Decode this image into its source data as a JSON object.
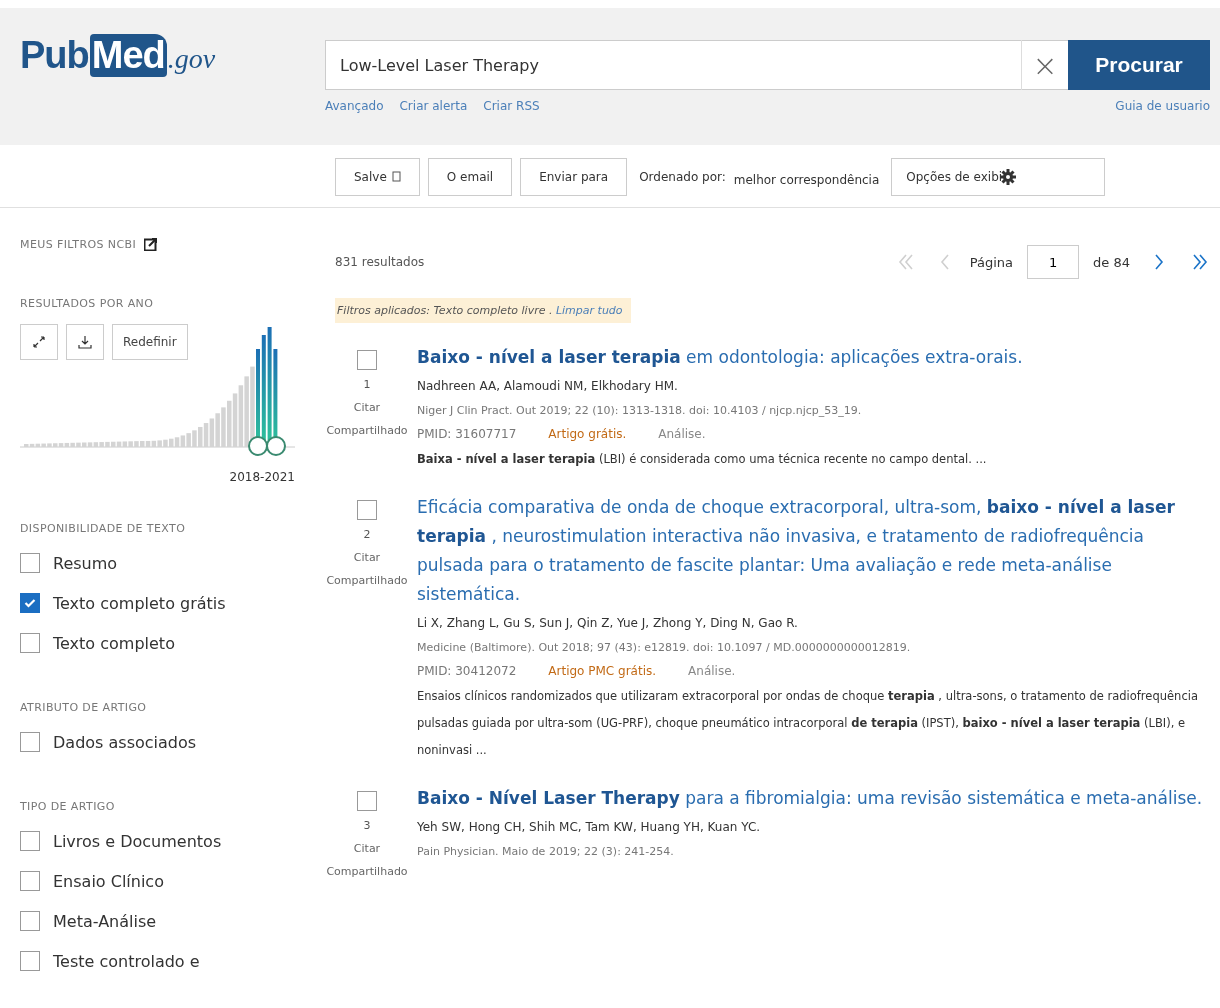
{
  "header": {
    "logo": {
      "prefix": "Pub",
      "main": "Med",
      "suffix": ".gov"
    },
    "search": {
      "value": "Low-Level Laser Therapy",
      "clear": "×",
      "button": "Procurar"
    },
    "links": [
      "Avançado",
      "Criar alerta",
      "Criar RSS"
    ],
    "guide_link": "Guia de usuario"
  },
  "toolbar": {
    "buttons": [
      {
        "kind": "save",
        "label": "Salve"
      },
      {
        "kind": "plain",
        "label": "O email"
      },
      {
        "kind": "plain",
        "label": "Enviar para"
      }
    ],
    "sort_label": "Ordenado por:",
    "sort_value": "melhor correspondência",
    "display_button": "Opções de exibi"
  },
  "sidebar": {
    "my_filters": "MEUS FILTROS NCBI",
    "year_section": {
      "title": "RESULTADOS POR ANO",
      "reset": "Redefinir",
      "range": "2018-2021"
    },
    "groups": [
      {
        "title": "DISPONIBILIDADE DE TEXTO",
        "items": [
          {
            "label": "Resumo",
            "checked": false
          },
          {
            "label": "Texto completo grátis",
            "checked": true
          },
          {
            "label": "Texto completo",
            "checked": false
          }
        ]
      },
      {
        "title": "ATRIBUTO DE ARTIGO",
        "items": [
          {
            "label": "Dados associados",
            "checked": false
          }
        ]
      },
      {
        "title": "TIPO DE ARTIGO",
        "items": [
          {
            "label": "Livros e Documentos",
            "checked": false
          },
          {
            "label": "Ensaio Clínico",
            "checked": false
          },
          {
            "label": "Meta-Análise",
            "checked": false
          },
          {
            "label": "Teste controlado e",
            "checked": false
          }
        ]
      }
    ]
  },
  "results_count": "831 resultados",
  "pager": {
    "label": "Página",
    "value": "1",
    "total": "de 84",
    "buttons": [
      {
        "kind": "first",
        "disabled": true
      },
      {
        "kind": "prev",
        "disabled": true
      },
      {
        "kind": "next",
        "disabled": false
      },
      {
        "kind": "last",
        "disabled": false
      }
    ]
  },
  "applied_filters": {
    "text": "Filtros aplicados: Texto completo livre .",
    "clear": "Limpar tudo"
  },
  "results": [
    {
      "number": "1",
      "checked": false,
      "cite": "Citar",
      "share": "Compartilhado",
      "title": "**Baixo - nível a laser terapia** em odontologia: aplicações extra-orais.",
      "authors": "Nadhreen AA, Alamoudi NM, Elkhodary HM.",
      "citation": "Niger J Clin Pract. Out 2019; 22 (10): 1313-1318. doi: 10.4103 / njcp.njcp_53_19.",
      "pmid": "PMID: 31607717",
      "badge": "Artigo grátis.",
      "type": "Análise.",
      "snippet": "**Baixa - nível a laser terapia** (LBI) é considerada como uma técnica recente no campo dental. ..."
    },
    {
      "number": "2",
      "checked": false,
      "cite": "Citar",
      "share": "Compartilhado",
      "title": "Eficácia comparativa de onda de choque extracorporal, ultra-som, **baixo - nível a laser terapia** , neurostimulation interactiva não invasiva, e tratamento de radiofrequência pulsada para o tratamento de fascite plantar: Uma avaliação e rede meta-análise sistemática.",
      "authors": "Li X, Zhang L, Gu S, Sun J, Qin Z, Yue J, Zhong Y, Ding N, Gao R.",
      "citation": "Medicine (Baltimore). Out 2018; 97 (43): e12819. doi: 10.1097 / MD.0000000000012819.",
      "pmid": "PMID: 30412072",
      "badge": "Artigo PMC grátis.",
      "type": "Análise.",
      "snippet": "Ensaios clínicos randomizados que utilizaram extracorporal por ondas de choque **terapia** , ultra-sons, o tratamento de radiofrequência pulsadas guiada por ultra-som (UG-PRF), choque pneumático intracorporal **de terapia** (IPST), **baixo - nível a laser terapia** (LBI), e noninvasi ..."
    },
    {
      "number": "3",
      "checked": false,
      "cite": "Citar",
      "share": "Compartilhado",
      "title": "**Baixo - Nível Laser Therapy** para a fibromialgia: uma revisão sistemática e meta-análise.",
      "authors": "Yeh SW, Hong CH, Shih MC, Tam KW, Huang YH, Kuan YC.",
      "citation": "Pain Physician. Maio de 2019; 22 (3): 241-254."
    }
  ]
}
